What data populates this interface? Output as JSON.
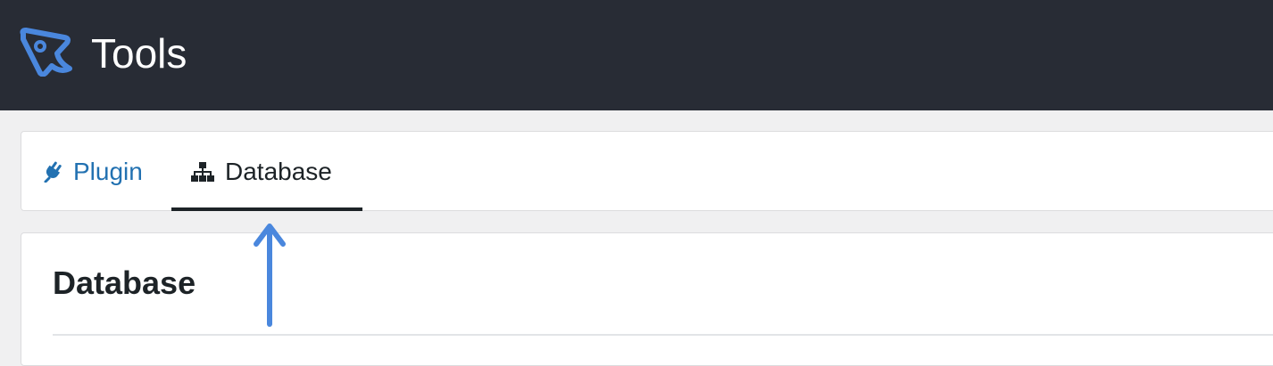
{
  "header": {
    "title": "Tools",
    "logo_icon": "maptool-logo-icon",
    "background": "#282c35"
  },
  "tabs": [
    {
      "label": "Plugin",
      "icon": "plug-icon",
      "active": false,
      "color": "#2271b1"
    },
    {
      "label": "Database",
      "icon": "sitemap-icon",
      "active": true,
      "color": "#1d2327"
    }
  ],
  "main": {
    "section_title": "Database"
  },
  "annotation": {
    "arrow_icon": "arrow-up-icon",
    "color": "#4a87dd"
  }
}
